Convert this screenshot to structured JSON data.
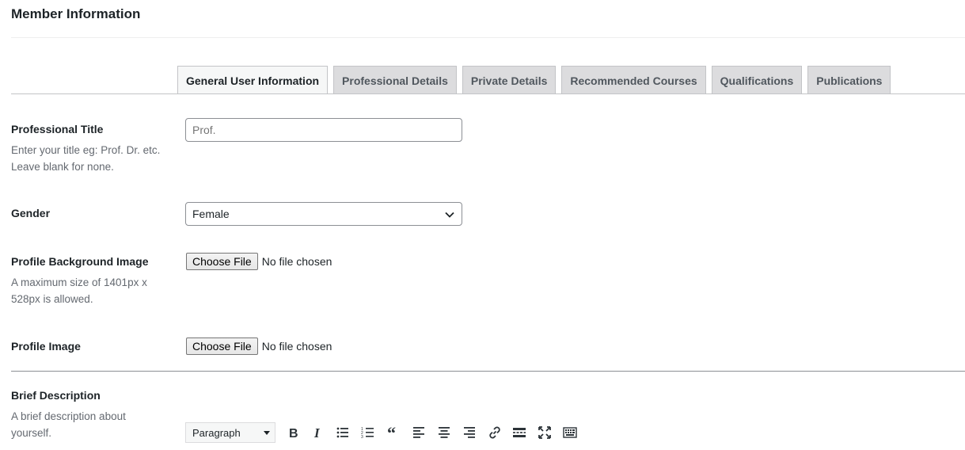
{
  "panel": {
    "title": "Member Information"
  },
  "tabs": [
    {
      "label": "General User Information",
      "active": true
    },
    {
      "label": "Professional Details",
      "active": false
    },
    {
      "label": "Private Details",
      "active": false
    },
    {
      "label": "Recommended Courses",
      "active": false
    },
    {
      "label": "Qualifications",
      "active": false
    },
    {
      "label": "Publications",
      "active": false
    }
  ],
  "fields": {
    "professional_title": {
      "label": "Professional Title",
      "desc_line1": "Enter your title eg: Prof. Dr. etc.",
      "desc_line2": "Leave blank for none.",
      "placeholder": "Prof.",
      "value": ""
    },
    "gender": {
      "label": "Gender",
      "value": "Female"
    },
    "profile_background_image": {
      "label": "Profile Background Image",
      "desc_line1": "A maximum size of 1401px x",
      "desc_line2": "528px is allowed.",
      "button": "Choose File",
      "status": "No file chosen"
    },
    "profile_image": {
      "label": "Profile Image",
      "button": "Choose File",
      "status": "No file chosen"
    },
    "brief_description": {
      "label": "Brief Description",
      "desc_line1": "A brief description about",
      "desc_line2": "yourself."
    }
  },
  "editor": {
    "format_value": "Paragraph",
    "icons": [
      "bold-icon",
      "italic-icon",
      "bullet-list-icon",
      "numbered-list-icon",
      "blockquote-icon",
      "align-left-icon",
      "align-center-icon",
      "align-right-icon",
      "link-icon",
      "read-more-icon",
      "fullscreen-icon",
      "toolbar-toggle-icon"
    ]
  }
}
